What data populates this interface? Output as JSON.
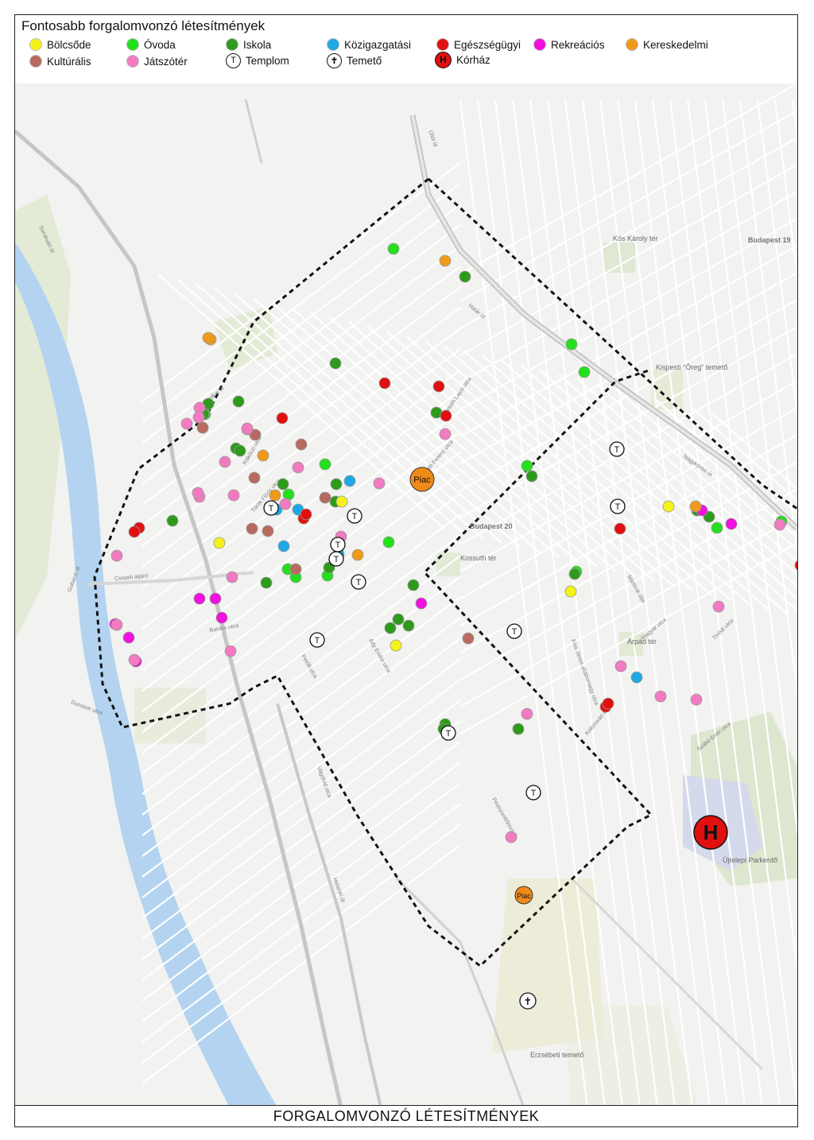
{
  "legend": {
    "title": "Fontosabb forgalomvonzó létesítmények",
    "items": {
      "bolcsode": {
        "label": "Bölcsőde",
        "color": "#f5f21a"
      },
      "ovoda": {
        "label": "Óvoda",
        "color": "#22e01a"
      },
      "iskola": {
        "label": "Iskola",
        "color": "#2e9a1c"
      },
      "kozigazgatasi": {
        "label": "Közigazgatási",
        "color": "#1ea8e6"
      },
      "egeszsegugyi": {
        "label": "Egészségügyi",
        "color": "#e01010"
      },
      "rekreacios": {
        "label": "Rekreációs",
        "color": "#f010e0"
      },
      "kereskedelmi": {
        "label": "Kereskedelmi",
        "color": "#f09a1a"
      },
      "kulturalis": {
        "label": "Kultúrális",
        "color": "#b86a60"
      },
      "jatszoter": {
        "label": "Játszótér",
        "color": "#f27ac0"
      },
      "templom": {
        "label": "Templom",
        "symbol": "T"
      },
      "temeto": {
        "label": "Temető",
        "symbol": "✝"
      },
      "korhaz": {
        "label": "Kórház",
        "symbol": "H",
        "color": "#e01010"
      }
    }
  },
  "footer": {
    "title": "FORGALOMVONZÓ LÉTESÍTMÉNYEK"
  },
  "map": {
    "piac_label": "Piac",
    "hospital_symbol": "H",
    "church_symbol": "T",
    "cemetery_symbol": "✝",
    "districts": [
      "Budapest 19",
      "Budapest 20"
    ],
    "places": [
      "Kispesti \"Öreg\" temető",
      "Erzsébeti temető",
      "Újtelepi Parkerdő",
      "Kós Károly tér",
      "Árpád tér",
      "Kossuth tér"
    ],
    "streets": [
      "Határ út",
      "Nagykőrösi út",
      "Gubacsi út",
      "Helsinki út",
      "Soroksári út",
      "Csepeli átjáró",
      "Szabadkai út",
      "Ady Endre utca",
      "Kossuth Lajos utca",
      "Török Flóris utca",
      "Mártírok útja",
      "Vágóhíd utca",
      "Baross utca",
      "Kossuth Ferenc utca",
      "Üllői út",
      "Pestszentlőrinci út",
      "Kiss János altábornagy utca",
      "Dunasor utca",
      "Szabó Ervin utca",
      "Tinódi utca",
      "Magyar utca",
      "Rákóczi utca",
      "Petőfi utca",
      "Kolozsvári utca"
    ]
  },
  "chart_data": {
    "type": "map",
    "categories": [
      "Bölcsőde",
      "Óvoda",
      "Iskola",
      "Közigazgatási",
      "Egészségügyi",
      "Rekreációs",
      "Kereskedelmi",
      "Kultúrális",
      "Játszótér",
      "Templom",
      "Temető",
      "Kórház"
    ],
    "poi_counts": {
      "Bölcsőde": 5,
      "Óvoda": 14,
      "Iskola": 25,
      "Közigazgatási": 6,
      "Egészségügyi": 12,
      "Rekreációs": 9,
      "Kereskedelmi": 8,
      "Kultúrális": 9,
      "Játszótér": 26,
      "Templom": 9,
      "Temető": 1,
      "Kórház": 1,
      "Piac": 2
    }
  }
}
